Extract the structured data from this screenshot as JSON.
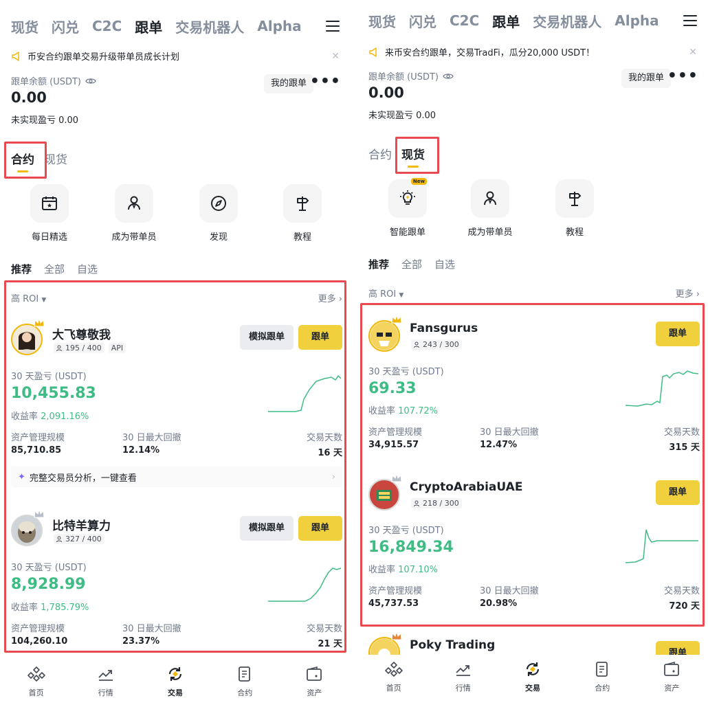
{
  "left": {
    "nav_tabs": [
      "现货",
      "闪兑",
      "C2C",
      "跟单",
      "交易机器人",
      "Alpha"
    ],
    "banner": "币安合约跟单交易升级带单员成长计划",
    "balance_label": "跟单余额 (USDT)",
    "balance_value": "0.00",
    "unrealized": "未实现盈亏 0.00",
    "my_copy_label": "我的跟单",
    "mode_tabs": [
      "合约",
      "现货"
    ],
    "quick": [
      "每日精选",
      "成为带单员",
      "发现",
      "教程"
    ],
    "sub_tabs": [
      "推荐",
      "全部",
      "自选"
    ],
    "sort_label": "高 ROI",
    "more_label": "更多",
    "mock_label": "模拟跟单",
    "copy_label": "跟单",
    "pnl_label": "30 天盈亏 (USDT)",
    "roi_label": "收益率",
    "aum_label": "资产管理规模",
    "mdd_label": "30 日最大回撤",
    "days_label": "交易天数",
    "analysis_label": "完整交易员分析，一键查看",
    "traders": [
      {
        "name": "大飞尊敬我",
        "slots": "195 / 400",
        "tag": "API",
        "pnl": "10,455.83",
        "roi": "2,091.16%",
        "aum": "85,710.85",
        "mdd": "12.14%",
        "days": "16 天"
      },
      {
        "name": "比特羊算力",
        "slots": "327 / 400",
        "tag": "",
        "pnl": "8,928.99",
        "roi": "1,785.79%",
        "aum": "104,260.10",
        "mdd": "23.37%",
        "days": "21 天"
      }
    ],
    "bottom_nav": [
      "首页",
      "行情",
      "交易",
      "合约",
      "资产"
    ]
  },
  "right": {
    "nav_tabs": [
      "现货",
      "闪兑",
      "C2C",
      "跟单",
      "交易机器人",
      "Alpha"
    ],
    "banner": "来币安合约跟单，交易TradFi，瓜分20,000 USDT！",
    "balance_label": "跟单余额 (USDT)",
    "balance_value": "0.00",
    "unrealized": "未实现盈亏 0.00",
    "my_copy_label": "我的跟单",
    "mode_tabs": [
      "合约",
      "现货"
    ],
    "quick": [
      "智能跟单",
      "成为带单员",
      "教程"
    ],
    "new_badge": "New",
    "sub_tabs": [
      "推荐",
      "全部",
      "自选"
    ],
    "sort_label": "高 ROI",
    "more_label": "更多",
    "copy_label": "跟单",
    "pnl_label": "30 天盈亏 (USDT)",
    "roi_label": "收益率",
    "aum_label": "资产管理规模",
    "mdd_label": "30 日最大回撤",
    "days_label": "交易天数",
    "traders": [
      {
        "name": "Fansgurus",
        "slots": "243 / 300",
        "pnl": "69.33",
        "roi": "107.72%",
        "aum": "34,915.57",
        "mdd": "12.47%",
        "days": "315 天"
      },
      {
        "name": "CryptoArabiaUAE",
        "slots": "218 / 300",
        "pnl": "16,849.34",
        "roi": "107.10%",
        "aum": "45,737.53",
        "mdd": "20.98%",
        "days": "720 天"
      },
      {
        "name": "Poky Trading"
      }
    ],
    "bottom_nav": [
      "首页",
      "行情",
      "交易",
      "合约",
      "资产"
    ]
  },
  "colors": {
    "accent": "#f0b90b",
    "profit": "#3dbc84",
    "highlight": "#e84a4f",
    "button": "#f0d03c"
  }
}
